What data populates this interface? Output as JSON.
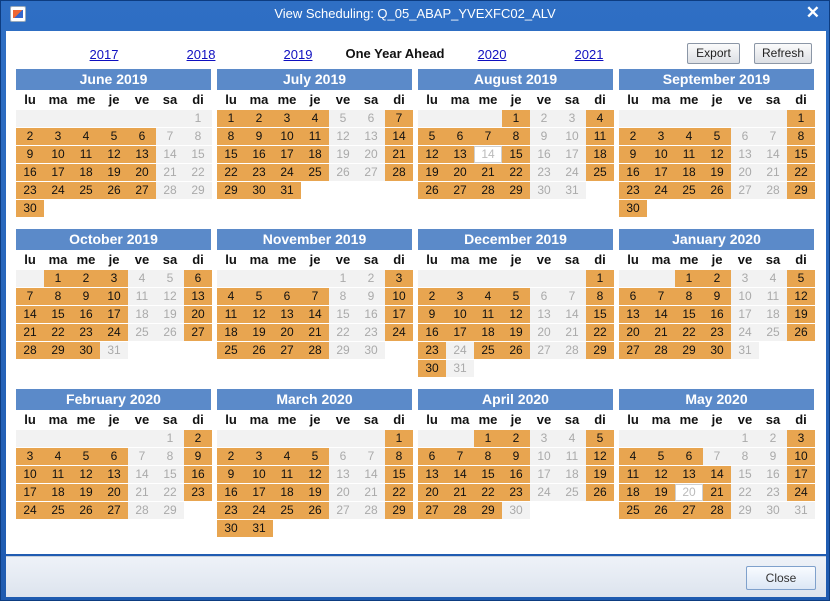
{
  "window": {
    "title": "View Scheduling: Q_05_ABAP_YVEXFC02_ALV"
  },
  "nav": {
    "links": [
      "2017",
      "2018",
      "2019",
      "One Year Ahead",
      "2020",
      "2021"
    ]
  },
  "toolbar": {
    "export_label": "Export",
    "refresh_label": "Refresh"
  },
  "weekdays": [
    "lu",
    "ma",
    "me",
    "je",
    "ve",
    "sa",
    "di"
  ],
  "colors": {
    "highlight": "#e8a550",
    "month_header": "#5b8ac9"
  },
  "months": [
    {
      "title": "June 2019",
      "first_dow": 6,
      "days": 30,
      "highlighted": [
        2,
        3,
        4,
        5,
        6,
        9,
        10,
        11,
        12,
        13,
        16,
        17,
        18,
        19,
        20,
        23,
        24,
        25,
        26,
        27,
        30
      ]
    },
    {
      "title": "July 2019",
      "first_dow": 0,
      "days": 31,
      "highlighted": [
        1,
        2,
        3,
        4,
        7,
        8,
        9,
        10,
        11,
        14,
        15,
        16,
        17,
        18,
        21,
        22,
        23,
        24,
        25,
        28,
        29,
        30,
        31
      ]
    },
    {
      "title": "August 2019",
      "first_dow": 3,
      "days": 31,
      "highlighted": [
        1,
        4,
        5,
        6,
        7,
        8,
        11,
        12,
        13,
        15,
        18,
        19,
        20,
        21,
        22,
        25,
        26,
        27,
        28,
        29
      ],
      "outlined": [
        14
      ]
    },
    {
      "title": "September 2019",
      "first_dow": 6,
      "days": 30,
      "highlighted": [
        1,
        2,
        3,
        4,
        5,
        8,
        9,
        10,
        11,
        12,
        15,
        16,
        17,
        18,
        19,
        22,
        23,
        24,
        25,
        26,
        29,
        30
      ]
    },
    {
      "title": "October 2019",
      "first_dow": 1,
      "days": 31,
      "highlighted": [
        1,
        2,
        3,
        6,
        7,
        8,
        9,
        10,
        13,
        14,
        15,
        16,
        17,
        20,
        21,
        22,
        23,
        24,
        27,
        28,
        29,
        30
      ]
    },
    {
      "title": "November 2019",
      "first_dow": 4,
      "days": 30,
      "highlighted": [
        3,
        4,
        5,
        6,
        7,
        10,
        11,
        12,
        13,
        14,
        17,
        18,
        19,
        20,
        21,
        24,
        25,
        26,
        27,
        28
      ]
    },
    {
      "title": "December 2019",
      "first_dow": 6,
      "days": 31,
      "highlighted": [
        1,
        2,
        3,
        4,
        5,
        8,
        9,
        10,
        11,
        12,
        15,
        16,
        17,
        18,
        19,
        22,
        23,
        25,
        26,
        29,
        30
      ]
    },
    {
      "title": "January 2020",
      "first_dow": 2,
      "days": 31,
      "highlighted": [
        1,
        2,
        5,
        6,
        7,
        8,
        9,
        12,
        13,
        14,
        15,
        16,
        19,
        20,
        21,
        22,
        23,
        26,
        27,
        28,
        29,
        30
      ]
    },
    {
      "title": "February 2020",
      "first_dow": 5,
      "days": 29,
      "highlighted": [
        2,
        3,
        4,
        5,
        6,
        9,
        10,
        11,
        12,
        13,
        16,
        17,
        18,
        19,
        20,
        23,
        24,
        25,
        26,
        27
      ]
    },
    {
      "title": "March 2020",
      "first_dow": 6,
      "days": 31,
      "highlighted": [
        1,
        2,
        3,
        4,
        5,
        8,
        9,
        10,
        11,
        12,
        15,
        16,
        17,
        18,
        19,
        22,
        23,
        24,
        25,
        26,
        29,
        30,
        31
      ]
    },
    {
      "title": "April 2020",
      "first_dow": 2,
      "days": 30,
      "highlighted": [
        1,
        2,
        5,
        6,
        7,
        8,
        9,
        12,
        13,
        14,
        15,
        16,
        19,
        20,
        21,
        22,
        23,
        26,
        27,
        28,
        29
      ]
    },
    {
      "title": "May 2020",
      "first_dow": 4,
      "days": 31,
      "highlighted": [
        3,
        4,
        5,
        6,
        10,
        11,
        12,
        13,
        14,
        17,
        18,
        19,
        21,
        24,
        25,
        26,
        27,
        28
      ],
      "outlined": [
        20
      ]
    }
  ],
  "footer": {
    "close_label": "Close"
  }
}
